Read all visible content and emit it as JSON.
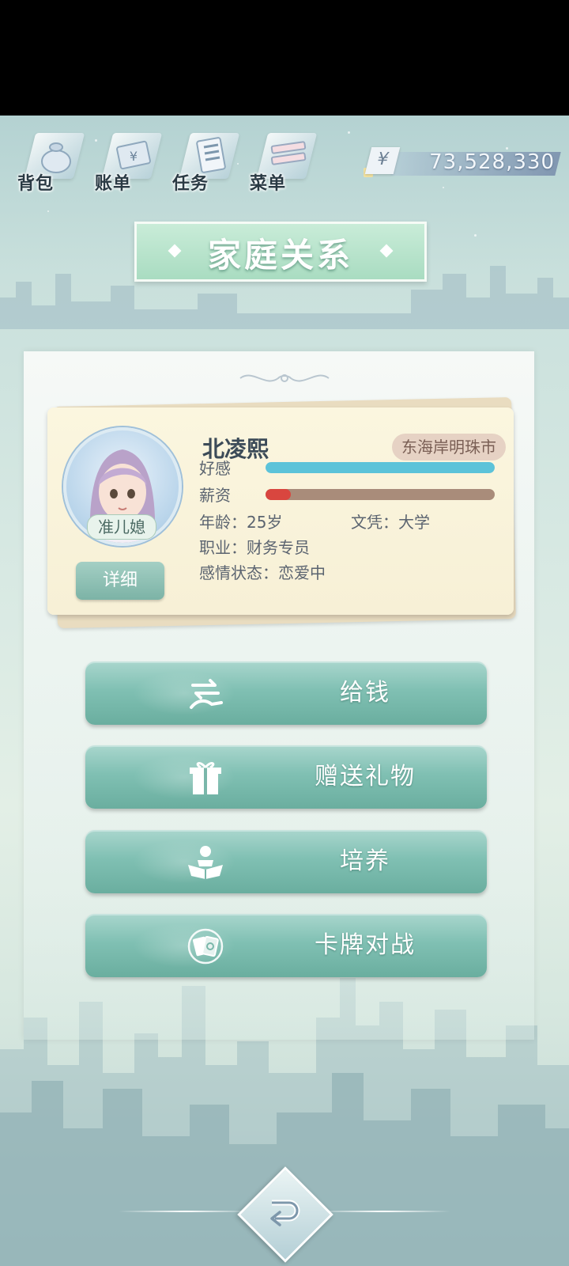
{
  "topbar": {
    "items": [
      {
        "label": "背包",
        "icon": "bag-icon"
      },
      {
        "label": "账单",
        "icon": "bill-icon"
      },
      {
        "label": "任务",
        "icon": "task-icon"
      },
      {
        "label": "菜单",
        "icon": "menu-icon"
      }
    ],
    "currency_symbol": "¥",
    "money": "73,528,330"
  },
  "title": "家庭关系",
  "character": {
    "name": "北凌熙",
    "location": "东海岸明珠市",
    "relation": "准儿媳",
    "detail_button": "详细",
    "affection_label": "好感",
    "affection_level": 1.0,
    "salary_label": "薪资",
    "salary_level": 0.11,
    "age": "年龄：25岁",
    "education": "文凭：大学",
    "job": "职业：财务专员",
    "relationship_status": "感情状态：恋爱中"
  },
  "actions": [
    {
      "label": "给钱",
      "icon": "give-money-icon"
    },
    {
      "label": "赠送礼物",
      "icon": "gift-icon"
    },
    {
      "label": "培养",
      "icon": "reading-person-icon"
    },
    {
      "label": "卡牌对战",
      "icon": "card-battle-icon"
    }
  ],
  "colors": {
    "affection_fill": "#5cc3d9",
    "salary_fill": "#d9463f",
    "salary_track": "#a98c7a",
    "accent_green": "#7cb8aa"
  }
}
